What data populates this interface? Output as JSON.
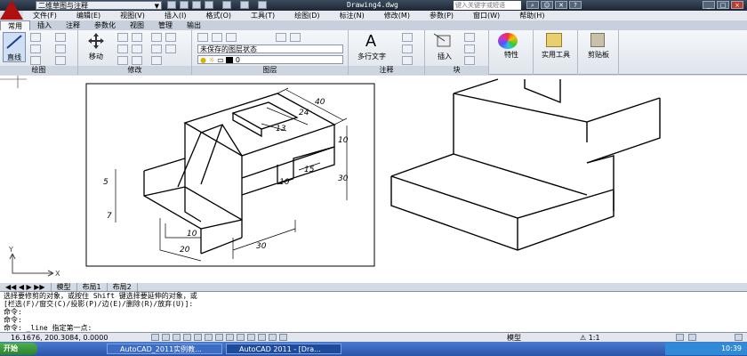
{
  "titlebar": {
    "workspace": "二维草图与注释",
    "drawing_title": "Drawing4.dwg",
    "search_placeholder": "键入关键字或短语"
  },
  "menu": [
    "文件(F)",
    "编辑(E)",
    "视图(V)",
    "插入(I)",
    "格式(O)",
    "工具(T)",
    "绘图(D)",
    "标注(N)",
    "修改(M)",
    "参数(P)",
    "窗口(W)",
    "帮助(H)"
  ],
  "tabs": [
    "常用",
    "插入",
    "注释",
    "参数化",
    "视图",
    "管理",
    "输出"
  ],
  "ribbon": {
    "line_label": "直线",
    "move_label": "移动",
    "layer_state": "未保存的图层状态",
    "layer_value": "0",
    "mtext_label": "多行文字",
    "insert_label": "插入",
    "properties_label": "特性",
    "utilities_label": "实用工具",
    "clipboard_label": "剪贴板",
    "panels": {
      "draw": "绘图",
      "modify": "修改",
      "layers": "图层",
      "annotation": "注释",
      "block": "块"
    }
  },
  "drawing_dims": {
    "d40": "40",
    "d24": "24",
    "d13": "13",
    "d10a": "10",
    "d30a": "30",
    "d15": "15",
    "d10b": "10",
    "d5": "5",
    "d7": "7",
    "d10c": "10",
    "d20": "20",
    "d30b": "30"
  },
  "ucs": {
    "x": "X",
    "y": "Y"
  },
  "model_tabs": [
    "模型",
    "布局1",
    "布局2"
  ],
  "command_lines": [
    "选择要修剪的对象，或按住 Shift 键选择要延伸的对象，或",
    "[栏选(F)/窗交(C)/投影(P)/边(E)/删除(R)/放弃(U)]:",
    "命令:",
    "命令:",
    "命令: _line 指定第一点:"
  ],
  "status": {
    "coords": "16.1676, 200.3084, 0.0000",
    "model": "模型",
    "scale": "1:1"
  },
  "taskbar": {
    "start": "开始",
    "item1": "AutoCAD_2011实例教...",
    "item2": "AutoCAD 2011 - [Dra...",
    "clock": "10:39"
  }
}
